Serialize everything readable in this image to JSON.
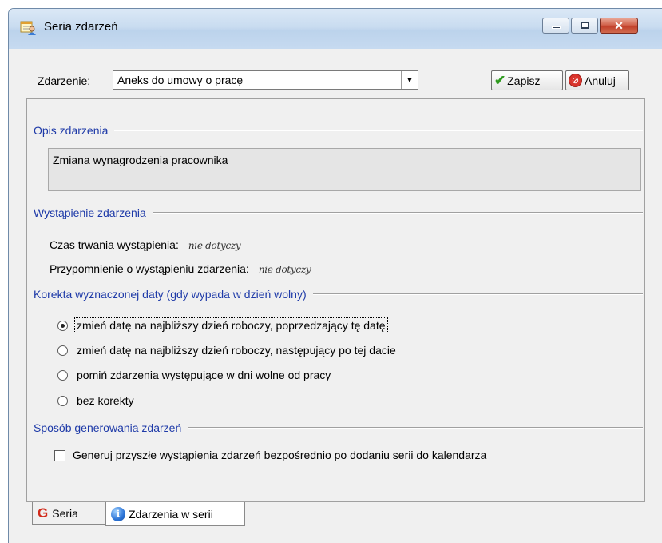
{
  "window": {
    "title": "Seria zdarzeń",
    "close_glyph": "✕"
  },
  "toolbar": {
    "event_label": "Zdarzenie:",
    "event_value": "Aneks do umowy o pracę",
    "save_label": "Zapisz",
    "cancel_label": "Anuluj"
  },
  "description": {
    "title": "Opis zdarzenia",
    "text": "Zmiana wynagrodzenia pracownika"
  },
  "occurrence": {
    "title": "Wystąpienie zdarzenia",
    "duration_label": "Czas trwania wystąpienia:",
    "duration_value": "nie dotyczy",
    "reminder_label": "Przypomnienie o wystąpieniu zdarzenia:",
    "reminder_value": "nie dotyczy"
  },
  "correction": {
    "title": "Korekta wyznaczonej daty (gdy wypada w dzień wolny)",
    "options": [
      {
        "label": "zmień datę na najbliższy dzień roboczy, poprzedzający tę datę",
        "selected": true
      },
      {
        "label": "zmień datę na najbliższy dzień roboczy, następujący po tej dacie",
        "selected": false
      },
      {
        "label": "pomiń zdarzenia występujące w dni wolne od pracy",
        "selected": false
      },
      {
        "label": "bez korekty",
        "selected": false
      }
    ]
  },
  "generation": {
    "title": "Sposób generowania zdarzeń",
    "checkbox_label": "Generuj przyszłe wystąpienia zdarzeń bezpośrednio po dodaniu serii do kalendarza",
    "checked": false
  },
  "tabs": [
    {
      "label": "Seria",
      "icon": "g-icon",
      "active": false
    },
    {
      "label": "Zdarzenia w serii",
      "icon": "info-icon",
      "active": true
    }
  ],
  "colors": {
    "section_title": "#1e3aa8",
    "window_bg": "#f0f0f0",
    "close_button": "#c2402a"
  }
}
